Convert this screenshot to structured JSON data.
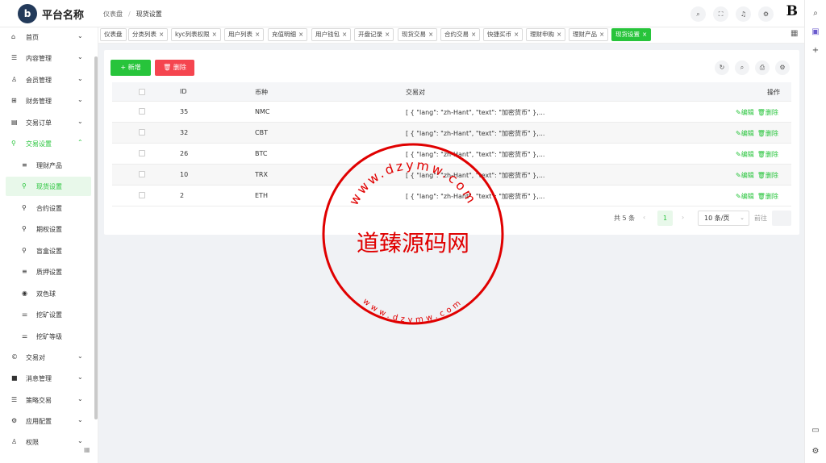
{
  "app": {
    "logo_letter": "b",
    "title": "平台名称"
  },
  "breadcrumb": {
    "root": "仪表盘",
    "separator": "/",
    "current": "现货设置"
  },
  "top_icons": [
    "search-icon",
    "fullscreen-icon",
    "bell-icon",
    "settings-icon"
  ],
  "brand_mark": "B",
  "sidebar": {
    "items": [
      {
        "icon": "⌂",
        "label": "首页",
        "chev": "⌄"
      },
      {
        "icon": "☰",
        "label": "内容管理",
        "chev": "⌄"
      },
      {
        "icon": "♙",
        "label": "会员管理",
        "chev": "⌄"
      },
      {
        "icon": "⊞",
        "label": "财务管理",
        "chev": "⌄"
      },
      {
        "icon": "▤",
        "label": "交易订单",
        "chev": "⌄"
      },
      {
        "icon": "⚲",
        "label": "交易设置",
        "chev": "⌃"
      },
      {
        "icon": "≡",
        "label": "理财产品"
      },
      {
        "icon": "⚲",
        "label": "现货设置"
      },
      {
        "icon": "⚲",
        "label": "合约设置"
      },
      {
        "icon": "⚲",
        "label": "期权设置"
      },
      {
        "icon": "⚲",
        "label": "盲盒设置"
      },
      {
        "icon": "≡",
        "label": "质押设置"
      },
      {
        "icon": "◉",
        "label": "双色球"
      },
      {
        "icon": "⚌",
        "label": "挖矿设置"
      },
      {
        "icon": "⚌",
        "label": "挖矿等级"
      },
      {
        "icon": "©",
        "label": "交易对",
        "chev": "⌄"
      },
      {
        "icon": "■",
        "label": "消息管理",
        "chev": "⌄"
      },
      {
        "icon": "☰",
        "label": "策略交易",
        "chev": "⌄"
      },
      {
        "icon": "⚙",
        "label": "应用配置",
        "chev": "⌄"
      },
      {
        "icon": "♙",
        "label": "权限",
        "chev": "⌄"
      }
    ]
  },
  "tabs": [
    {
      "label": "仪表盘"
    },
    {
      "label": "分类列表"
    },
    {
      "label": "kyc列表权限"
    },
    {
      "label": "用户列表"
    },
    {
      "label": "充值明细"
    },
    {
      "label": "用户钱包"
    },
    {
      "label": "开盘记录"
    },
    {
      "label": "现货交易"
    },
    {
      "label": "合约交易"
    },
    {
      "label": "快捷买币"
    },
    {
      "label": "理财申购"
    },
    {
      "label": "理财产品"
    },
    {
      "label": "现货设置"
    }
  ],
  "tab_close": "×",
  "toolbar": {
    "add_label": "新增",
    "add_icon": "+",
    "delete_label": "删除",
    "delete_icon": "🗑"
  },
  "table": {
    "columns": {
      "id": "ID",
      "coin": "币种",
      "pair": "交易对",
      "ops": "操作"
    },
    "rows": [
      {
        "id": "35",
        "coin": "NMC",
        "pair": "[ { \"lang\": \"zh-Hant\", \"text\": \"加密货币\" },..."
      },
      {
        "id": "32",
        "coin": "CBT",
        "pair": "[ { \"lang\": \"zh-Hant\", \"text\": \"加密货币\" },..."
      },
      {
        "id": "26",
        "coin": "BTC",
        "pair": "[ { \"lang\": \"zh-Hant\", \"text\": \"加密货币\" },..."
      },
      {
        "id": "10",
        "coin": "TRX",
        "pair": "[ { \"lang\": \"zh-Hant\", \"text\": \"加密货币\" },..."
      },
      {
        "id": "2",
        "coin": "ETH",
        "pair": "[ { \"lang\": \"zh-Hant\", \"text\": \"加密货币\" },..."
      }
    ],
    "edit_label": "✎编辑",
    "delete_label": "🗑删除"
  },
  "pagination": {
    "total": "共 5 条",
    "prev": "‹",
    "page": "1",
    "next": "›",
    "page_size": "10 条/页",
    "goto": "前往"
  },
  "watermark": {
    "center": "道臻源码网",
    "top_arc": "www.dzymw.com",
    "bottom_arc": "www.dzymw.com",
    "color": "#e00000"
  },
  "colors": {
    "accent": "#27c43b",
    "danger": "#f5454f"
  }
}
